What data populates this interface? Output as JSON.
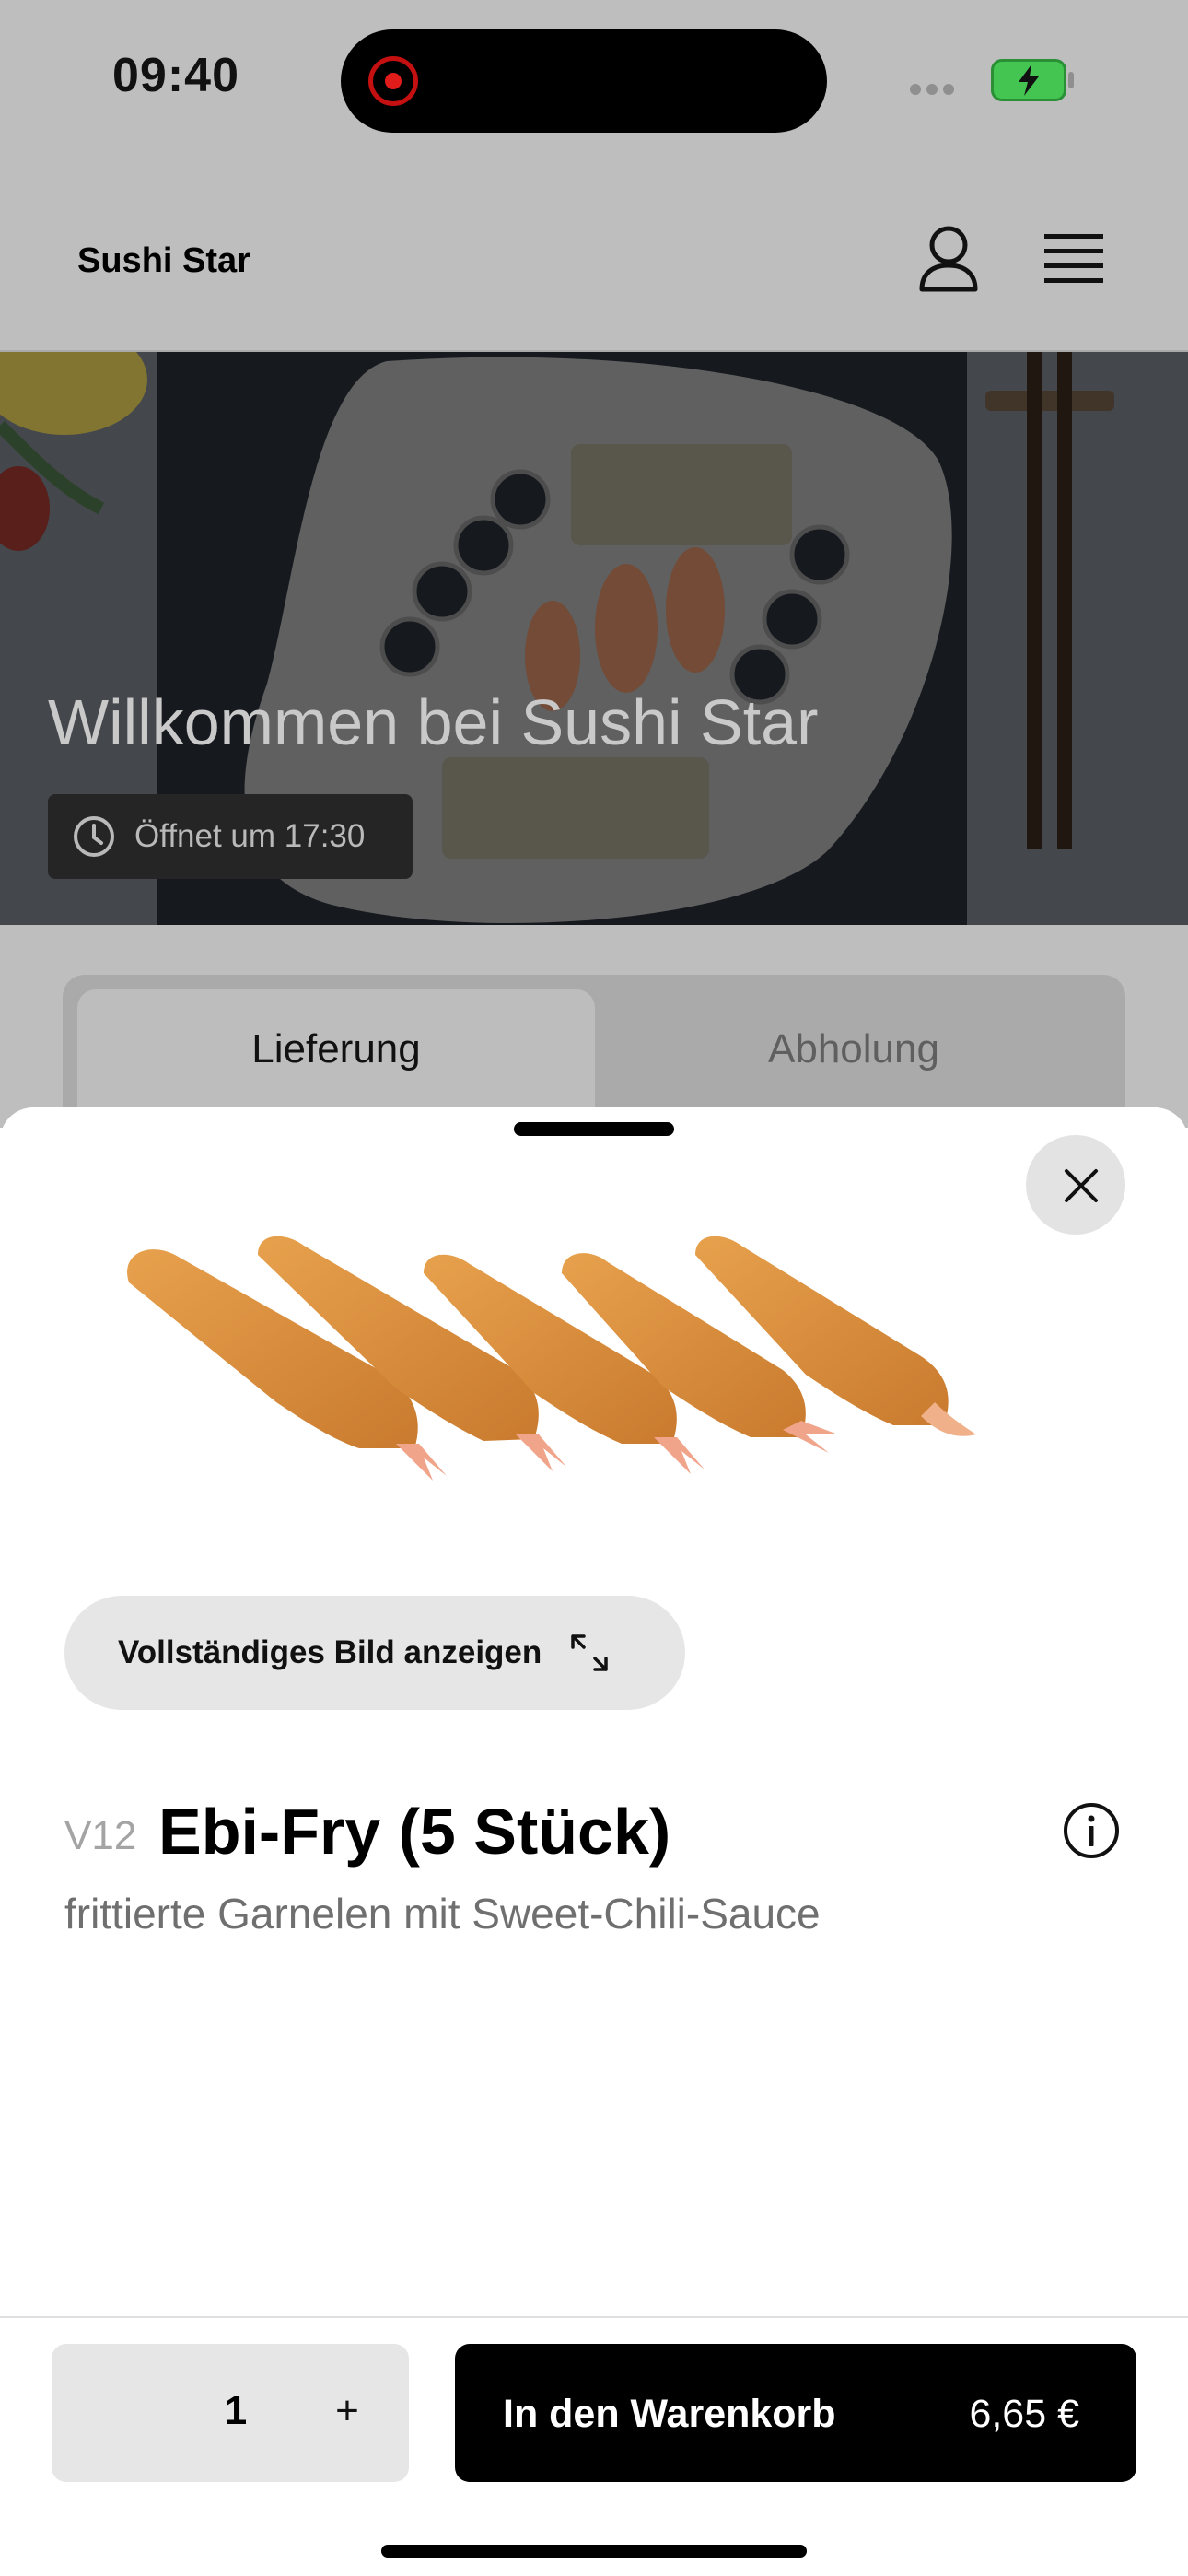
{
  "status_bar": {
    "time": "09:40"
  },
  "header": {
    "brand": "Sushi Star"
  },
  "hero": {
    "title": "Willkommen bei Sushi Star",
    "hours": "Öffnet um 17:30"
  },
  "order_mode": {
    "tabs": [
      {
        "label": "Lieferung",
        "active": true
      },
      {
        "label": "Abholung",
        "active": false
      }
    ]
  },
  "product": {
    "view_full_image": "Vollständiges Bild anzeigen",
    "code": "V12",
    "name": "Ebi-Fry (5 Stück)",
    "description": "frittierte Garnelen mit Sweet-Chili-Sauce"
  },
  "footer": {
    "quantity": "1",
    "plus": "+",
    "add_to_cart": "In den Warenkorb",
    "price": "6,65 €"
  },
  "icons": [
    "recording-icon",
    "battery-charging-icon",
    "profile-icon",
    "menu-icon",
    "clock-icon",
    "close-icon",
    "expand-icon",
    "info-icon"
  ],
  "colors": {
    "overlay": "#bebebe",
    "button_dark": "#000000",
    "chip": "#e6e6e6",
    "battery": "#44c552",
    "record": "#e21b1b"
  }
}
